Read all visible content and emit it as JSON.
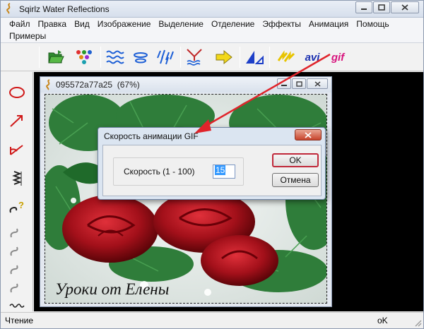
{
  "window": {
    "title": "Sqirlz Water Reflections"
  },
  "menu": [
    "Файл",
    "Правка",
    "Вид",
    "Изображение",
    "Выделение",
    "Отделение",
    "Эффекты",
    "Анимация",
    "Помощь",
    "Примеры"
  ],
  "toolbar": {
    "avi_label": "avi",
    "gif_label": "gif"
  },
  "document": {
    "title": "095572a77a25",
    "zoom": "(67%)",
    "caption": "Уроки от Елены"
  },
  "dialog": {
    "title": "Скорость анимации GIF",
    "speed_label": "Скорость (1 - 100)",
    "speed_value": "15",
    "ok_label": "OK",
    "cancel_label": "Отмена"
  },
  "status": {
    "left": "Чтение",
    "right": "оK"
  },
  "colors": {
    "annotation_arrow": "#e0242b",
    "gif_text": "#d8147d",
    "avi_text": "#1a2fb0"
  }
}
